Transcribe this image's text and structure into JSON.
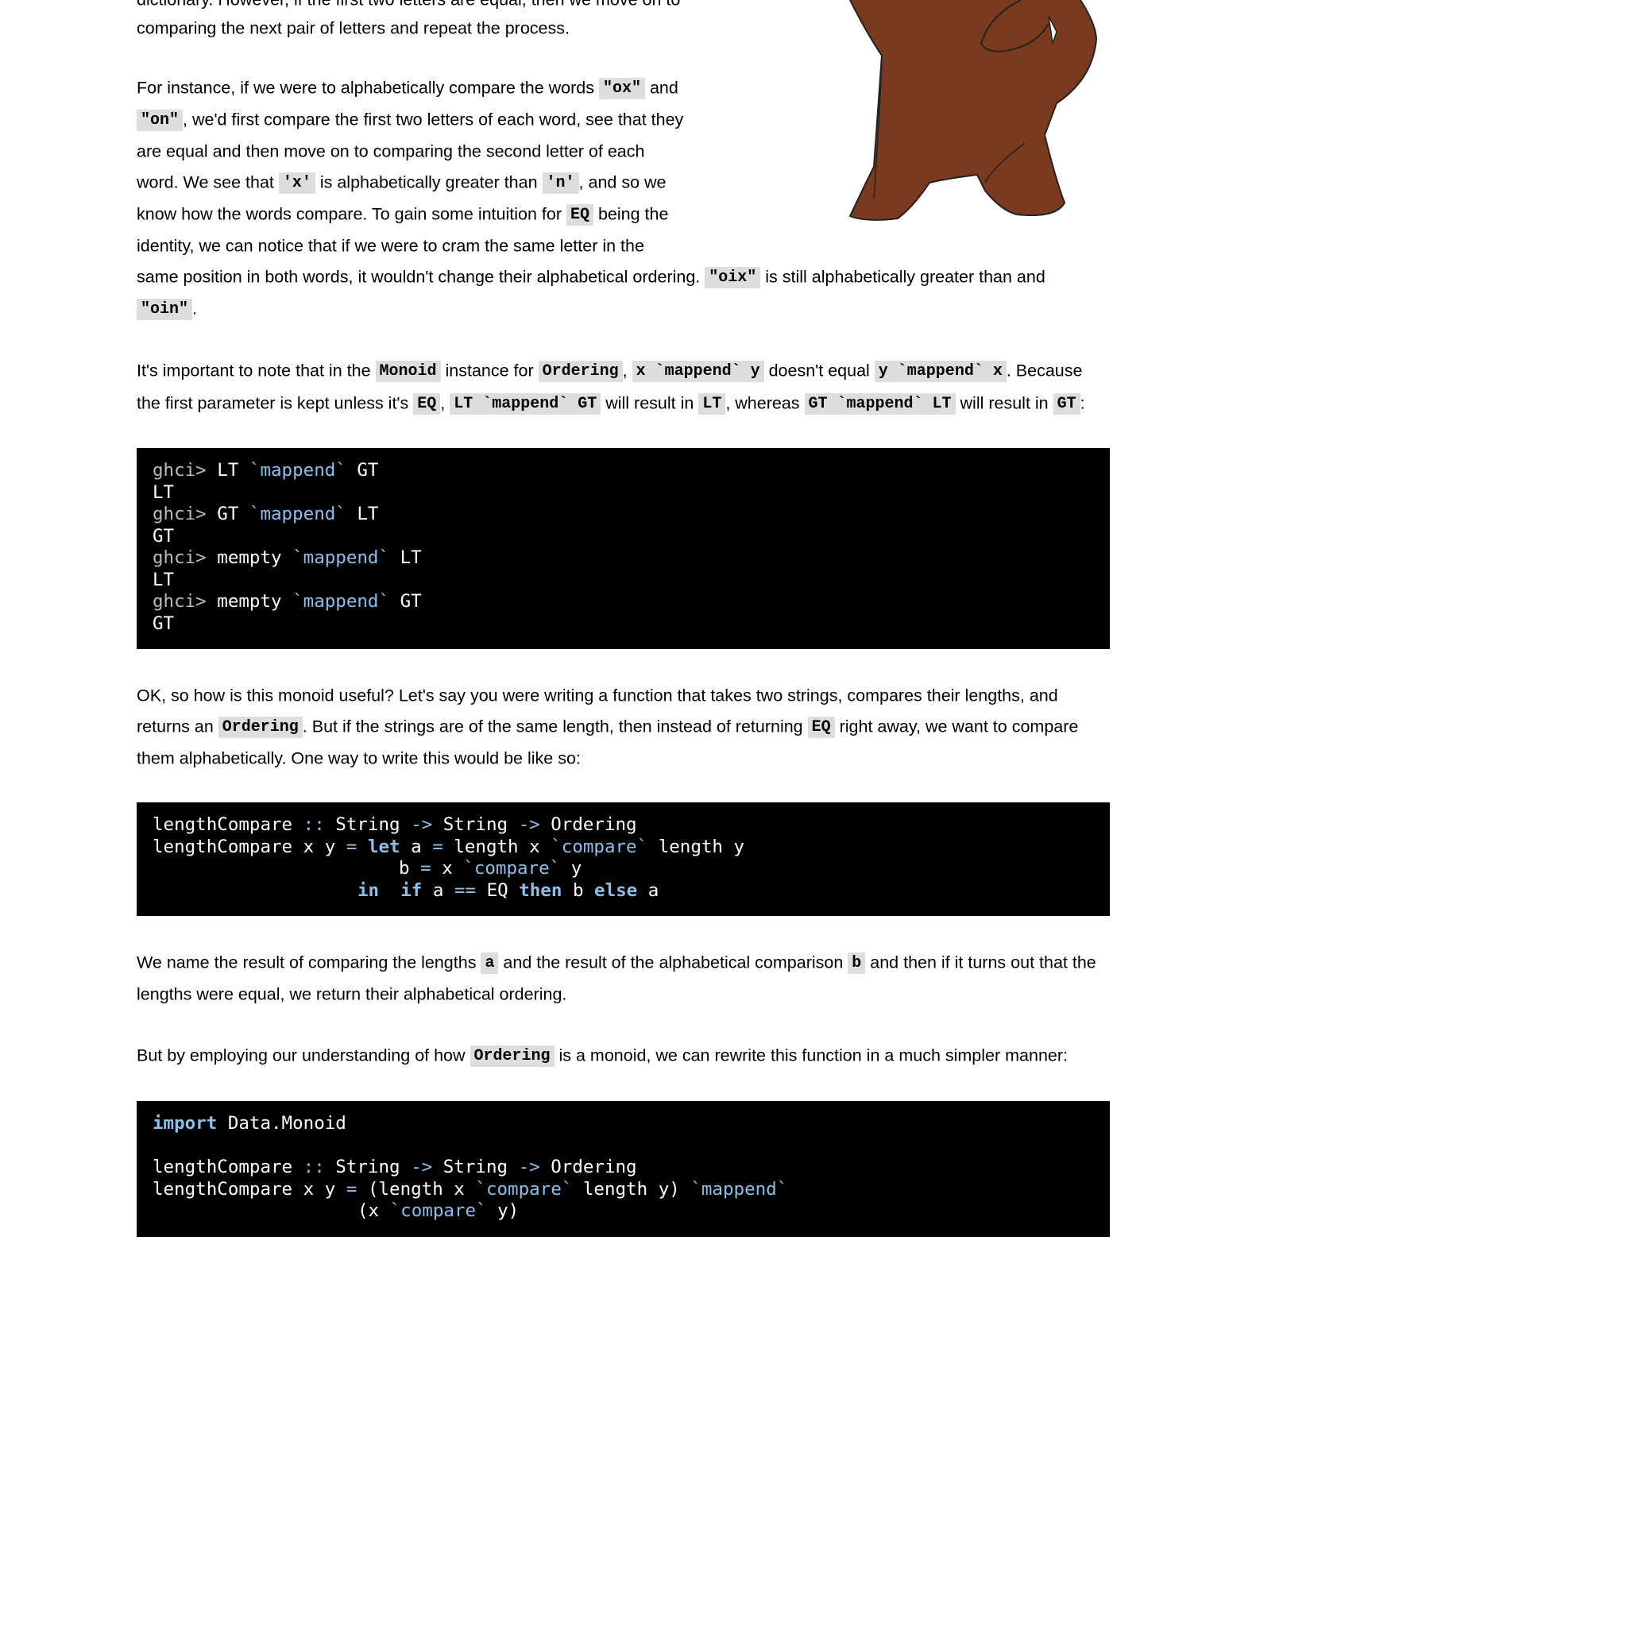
{
  "paragraphs": {
    "p0": {
      "line1": "dictionary. However, if the first two letters are equal, then we move on to",
      "line2": "comparing the next pair of letters and repeat the process."
    },
    "p1": {
      "l1_a": "For instance, if we were to alphabetically compare the words ",
      "l1_code1": "\"ox\"",
      "l1_b": " and",
      "l2_code1": "\"on\"",
      "l2_a": ", we'd first compare the first two letters of each word, see that they",
      "l3": "are equal and then move on to comparing the second letter of each",
      "l4_a": "word. We see that ",
      "l4_code1": "'x'",
      "l4_b": " is alphabetically greater than ",
      "l4_code2": "'n'",
      "l4_c": ", and so we",
      "l5_a": "know how the words compare. To gain some intuition for ",
      "l5_code1": "EQ",
      "l5_b": " being the",
      "l6": "identity, we can notice that if we were to cram the same letter in the",
      "l7_a": "same position in both words, it wouldn't change their alphabetical ordering. ",
      "l7_code1": "\"oix\"",
      "l7_b": " is still alphabetically greater than and",
      "l8_code1": "\"oin\"",
      "l8_a": "."
    },
    "p2": {
      "l1_a": "It's important to note that in the ",
      "l1_code1": "Monoid",
      "l1_b": " instance for ",
      "l1_code2": "Ordering",
      "l1_c": ", ",
      "l1_code3": "x `mappend` y",
      "l1_d": " doesn't equal ",
      "l1_code4": "y `mappend` x",
      "l1_e": ". Because",
      "l2_a": "the first parameter is kept unless it's ",
      "l2_code1": "EQ",
      "l2_b": ", ",
      "l2_code2": "LT `mappend` GT",
      "l2_c": " will result in ",
      "l2_code3": "LT",
      "l2_d": ", whereas ",
      "l2_code4": "GT `mappend` LT",
      "l2_e": " will result in ",
      "l2_code5": "GT",
      "l2_f": ":"
    },
    "p3": {
      "l1": "OK, so how is this monoid useful? Let's say you were writing a function that takes two strings, compares their lengths, and",
      "l2_a": "returns an ",
      "l2_code1": "Ordering",
      "l2_b": ". But if the strings are of the same length, then instead of returning ",
      "l2_code2": "EQ",
      "l2_c": " right away, we want to compare",
      "l3": "them alphabetically. One way to write this would be like so:"
    },
    "p4": {
      "l1_a": "We name the result of comparing the lengths ",
      "l1_code1": "a",
      "l1_b": " and the result of the alphabetical comparison ",
      "l1_code2": "b",
      "l1_c": " and then if it turns out that the",
      "l2": "lengths were equal, we return their alphabetical ordering."
    },
    "p5": {
      "l1_a": "But by employing our understanding of how ",
      "l1_code1": "Ordering",
      "l1_b": " is a monoid, we can rewrite this function in a much simpler manner:"
    }
  },
  "code_blocks": {
    "ghci": {
      "prompt": "ghci>",
      "lines": [
        {
          "input_a": "LT",
          "fn": "`mappend`",
          "input_b": "GT",
          "output": "LT"
        },
        {
          "input_a": "GT",
          "fn": "`mappend`",
          "input_b": "LT",
          "output": "GT"
        },
        {
          "input_a": "mempty",
          "fn": "`mappend`",
          "input_b": "LT",
          "output": "LT"
        },
        {
          "input_a": "mempty",
          "fn": "`mappend`",
          "input_b": "GT",
          "output": "GT"
        }
      ]
    },
    "length_compare_v1": {
      "l1_name": "lengthCompare",
      "l1_sig_sep": "::",
      "l1_t1": "String",
      "l1_arrow1": "->",
      "l1_t2": "String",
      "l1_arrow2": "->",
      "l1_t3": "Ordering",
      "l2_head": "lengthCompare x y",
      "l2_eq": "=",
      "l2_let": "let",
      "l2_a": "a",
      "l2_eq2": "=",
      "l2_expr_a": "length x",
      "l2_fn": "`compare`",
      "l2_expr_b": "length y",
      "l3_b": "b",
      "l3_eq": "=",
      "l3_x": "x",
      "l3_fn": "`compare`",
      "l3_y": "y",
      "l4_in": "in",
      "l4_if": "if",
      "l4_a": "a",
      "l4_eqeq": "==",
      "l4_eq": "EQ",
      "l4_then": "then",
      "l4_b": "b",
      "l4_else": "else",
      "l4_a2": "a"
    },
    "length_compare_v2": {
      "l1_import": "import",
      "l1_mod": "Data.Monoid",
      "l2_name": "lengthCompare",
      "l2_sig_sep": "::",
      "l2_t1": "String",
      "l2_arrow1": "->",
      "l2_t2": "String",
      "l2_arrow2": "->",
      "l2_t3": "Ordering",
      "l3_head": "lengthCompare x y",
      "l3_eq": "=",
      "l3_open": "(length x",
      "l3_fn": "`compare`",
      "l3_close": "length y)",
      "l3_mappend": "`mappend`",
      "l4_open": "(x",
      "l4_fn": "`compare`",
      "l4_close": "y)"
    }
  },
  "illustration": {
    "icon": "cartoon-bear-illustration"
  },
  "colors": {
    "code_bg": "#000000",
    "inline_code_bg": "#dddddd",
    "keyword": "#8fbfe6",
    "prompt": "#bbbbbb",
    "bear_fur": "#7a3a1e"
  }
}
